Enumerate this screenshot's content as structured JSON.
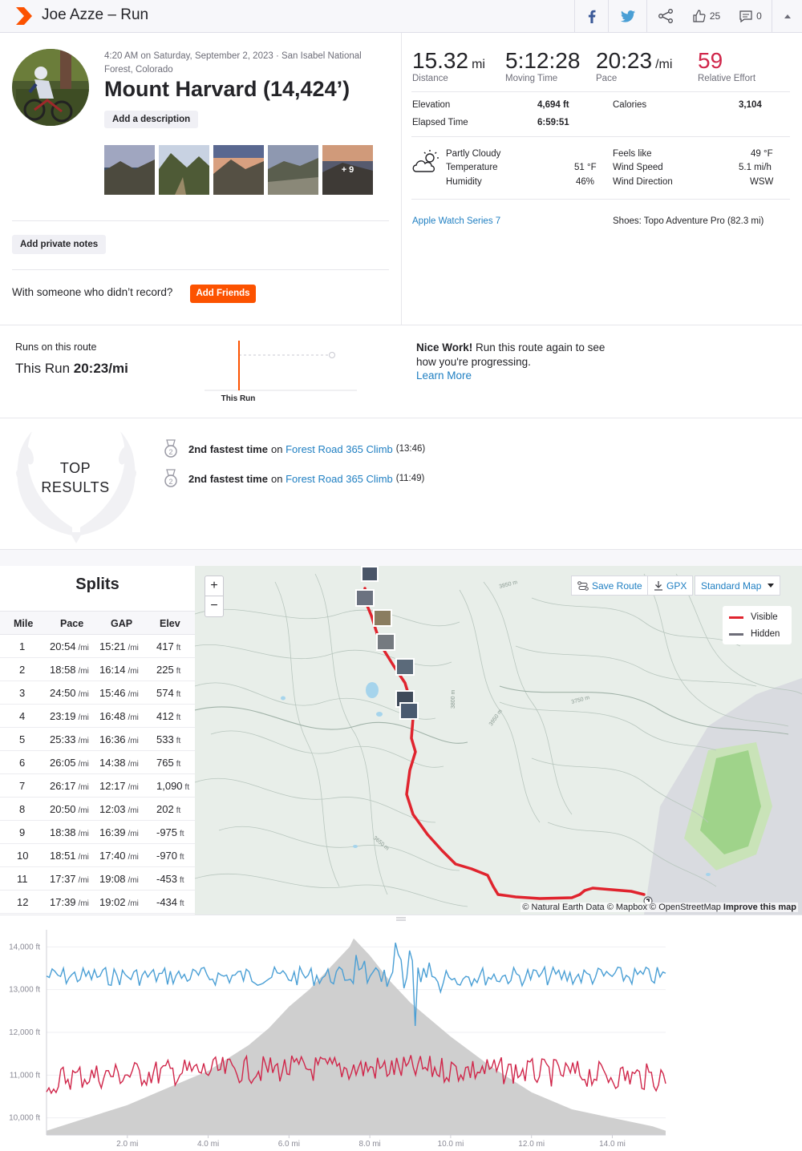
{
  "header": {
    "title": "Joe Azze – Run",
    "kudos_count": "25",
    "comments_count": "0"
  },
  "activity": {
    "meta": "4:20 AM on Saturday, September 2, 2023 · San Isabel National Forest, Colorado",
    "title": "Mount Harvard (14,424’)",
    "add_description": "Add a description",
    "photos_more": "+ 9",
    "add_private_notes": "Add private notes",
    "friends_prompt": "With someone who didn’t record?",
    "add_friends": "Add Friends"
  },
  "stats": {
    "distance": {
      "value": "15.32",
      "unit": "mi",
      "label": "Distance"
    },
    "moving_time": {
      "value": "5:12:28",
      "label": "Moving Time"
    },
    "pace": {
      "value": "20:23",
      "unit": "/mi",
      "label": "Pace"
    },
    "relative_effort": {
      "value": "59",
      "label": "Relative Effort"
    },
    "elevation": {
      "label": "Elevation",
      "value": "4,694 ft"
    },
    "calories": {
      "label": "Calories",
      "value": "3,104"
    },
    "elapsed": {
      "label": "Elapsed Time",
      "value": "6:59:51"
    }
  },
  "weather": {
    "condition": "Partly Cloudy",
    "temperature_label": "Temperature",
    "temperature": "51 °F",
    "humidity_label": "Humidity",
    "humidity": "46%",
    "feels_like_label": "Feels like",
    "feels_like": "49 °F",
    "wind_speed_label": "Wind Speed",
    "wind_speed": "5.1 mi/h",
    "wind_direction_label": "Wind Direction",
    "wind_direction": "WSW"
  },
  "gear": {
    "device": "Apple Watch Series 7",
    "shoes": "Shoes: Topo Adventure Pro (82.3 mi)"
  },
  "route": {
    "label": "Runs on this route",
    "this_run_prefix": "This Run",
    "this_run_pace": "20:23/mi",
    "chart_label": "This Run",
    "nice_bold": "Nice Work!",
    "nice_text": " Run this route again to see how you're progressing.",
    "learn_more": "Learn More"
  },
  "top_results": {
    "badge_line1": "TOP",
    "badge_line2": "RESULTS",
    "items": [
      {
        "rank": "2nd fastest time",
        "on": "on",
        "segment": "Forest Road 365 Climb",
        "time": "(13:46)"
      },
      {
        "rank": "2nd fastest time",
        "on": "on",
        "segment": "Forest Road 365 Climb",
        "time": "(11:49)"
      }
    ]
  },
  "splits": {
    "title": "Splits",
    "headers": [
      "Mile",
      "Pace",
      "GAP",
      "Elev"
    ],
    "pace_unit": "/mi",
    "elev_unit": "ft",
    "rows": [
      {
        "mile": "1",
        "pace": "20:54",
        "gap": "15:21",
        "elev": "417"
      },
      {
        "mile": "2",
        "pace": "18:58",
        "gap": "16:14",
        "elev": "225"
      },
      {
        "mile": "3",
        "pace": "24:50",
        "gap": "15:46",
        "elev": "574"
      },
      {
        "mile": "4",
        "pace": "23:19",
        "gap": "16:48",
        "elev": "412"
      },
      {
        "mile": "5",
        "pace": "25:33",
        "gap": "16:36",
        "elev": "533"
      },
      {
        "mile": "6",
        "pace": "26:05",
        "gap": "14:38",
        "elev": "765"
      },
      {
        "mile": "7",
        "pace": "26:17",
        "gap": "12:17",
        "elev": "1,090"
      },
      {
        "mile": "8",
        "pace": "20:50",
        "gap": "12:03",
        "elev": "202"
      },
      {
        "mile": "9",
        "pace": "18:38",
        "gap": "16:39",
        "elev": "-975"
      },
      {
        "mile": "10",
        "pace": "18:51",
        "gap": "17:40",
        "elev": "-970"
      },
      {
        "mile": "11",
        "pace": "17:37",
        "gap": "19:08",
        "elev": "-453"
      },
      {
        "mile": "12",
        "pace": "17:39",
        "gap": "19:02",
        "elev": "-434"
      }
    ]
  },
  "map": {
    "save_route": "Save Route",
    "gpx": "GPX",
    "map_type": "Standard Map",
    "legend_visible": "Visible",
    "legend_hidden": "Hidden",
    "attribution_1": "© Natural Earth Data © Mapbox © OpenStreetMap",
    "attribution_2": "Improve this map",
    "contour_labels": [
      "3850 m",
      "3800 m",
      "3750 m",
      "3650 m",
      "3950 m",
      "3550 m"
    ]
  },
  "colors": {
    "brand": "#fc5200",
    "link": "#1f7fc2",
    "route": "#e0242e",
    "pace_line": "#4a9fd5",
    "heart_line": "#d0264a",
    "elevation_fill": "#cfcfcf"
  },
  "chart_data": {
    "type": "area",
    "x_unit": "mi",
    "x_range": [
      0,
      15.32
    ],
    "x_ticks": [
      "2.0 mi",
      "4.0 mi",
      "6.0 mi",
      "8.0 mi",
      "10.0 mi",
      "12.0 mi",
      "14.0 mi"
    ],
    "y_ticks": [
      "14,000 ft",
      "13,000 ft",
      "12,000 ft",
      "11,000 ft",
      "10,000 ft"
    ],
    "ylim": [
      9600,
      14400
    ],
    "elevation": {
      "x": [
        0,
        1,
        2,
        3,
        4,
        5,
        5.5,
        6,
        6.5,
        7,
        7.5,
        7.6,
        8,
        8.5,
        9,
        10,
        11,
        12,
        13,
        14,
        15,
        15.32
      ],
      "y": [
        9700,
        10000,
        10300,
        10700,
        11100,
        11700,
        12100,
        12600,
        13000,
        13500,
        14000,
        14200,
        13800,
        13200,
        12700,
        11900,
        11200,
        10600,
        10200,
        10000,
        9800,
        9700
      ]
    },
    "series": [
      {
        "name": "Pace",
        "color": "#4a9fd5",
        "points": 220
      },
      {
        "name": "Heart Rate",
        "color": "#d0264a",
        "points": 260
      }
    ]
  }
}
